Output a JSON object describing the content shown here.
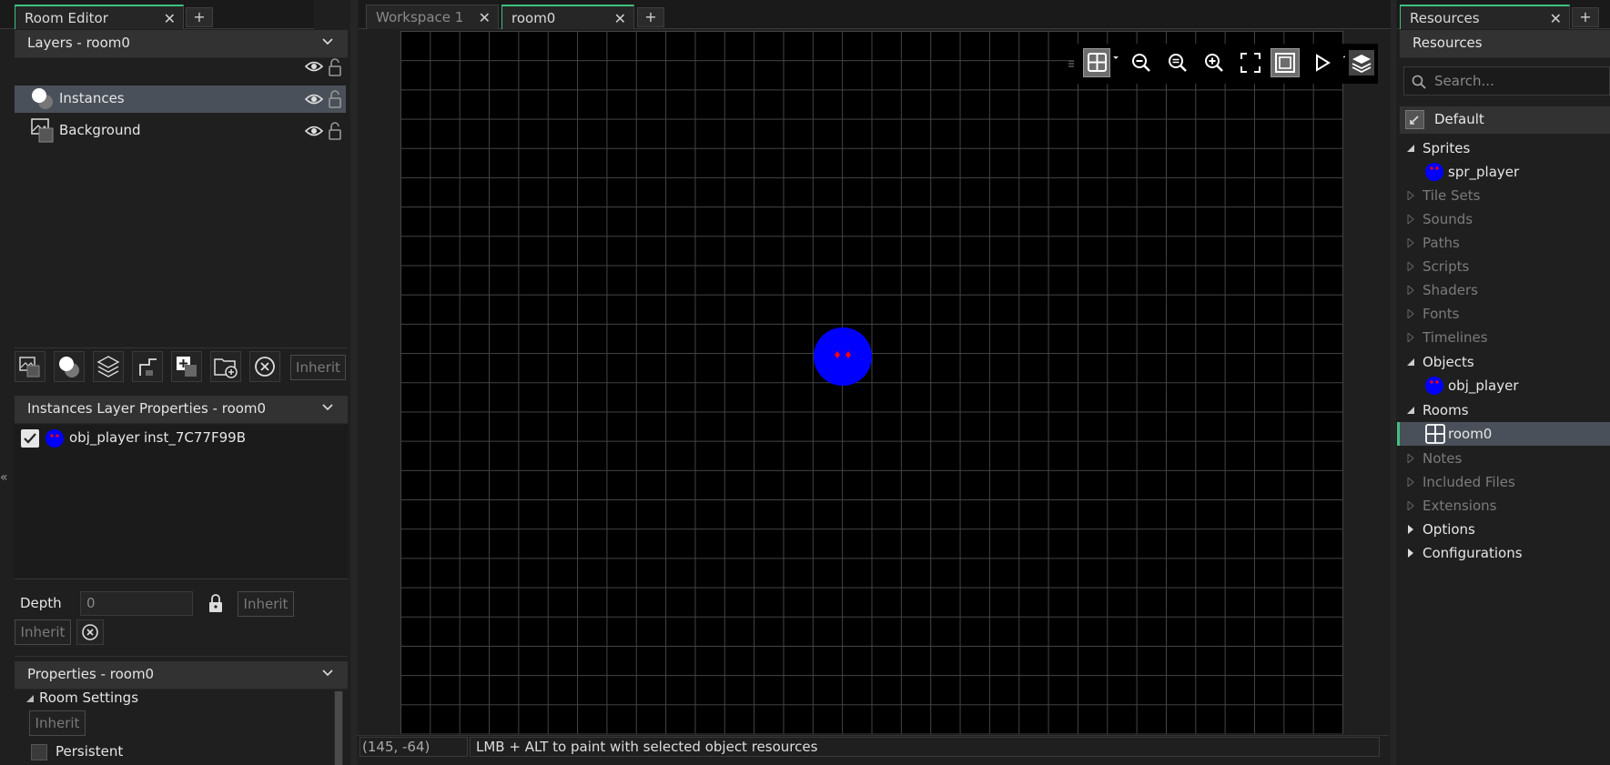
{
  "left": {
    "tab_label": "Room Editor",
    "layers_header": "Layers - room0",
    "layers": [
      {
        "name": "Instances",
        "icon": "instances-layer-icon",
        "selected": true
      },
      {
        "name": "Background",
        "icon": "background-layer-icon",
        "selected": false
      }
    ],
    "inherit_label": "Inherit",
    "inst_props_header": "Instances Layer Properties - room0",
    "instance": {
      "object": "obj_player",
      "id": "inst_7C77F99B",
      "checked": true
    },
    "depth_label": "Depth",
    "depth_value": "0",
    "inherit_depth_label": "Inherit",
    "inherit_layer_label": "Inherit",
    "properties_header": "Properties - room0",
    "room_settings_label": "Room Settings",
    "room_inherit_label": "Inherit",
    "persistent_label": "Persistent"
  },
  "center": {
    "tabs": [
      {
        "label": "Workspace 1",
        "active": false
      },
      {
        "label": "room0",
        "active": true
      }
    ],
    "toolbar": [
      "grid-toggle-icon",
      "zoom-out-icon",
      "zoom-reset-icon",
      "zoom-in-icon",
      "fit-icon",
      "frame-icon",
      "play-icon",
      "layers-toggle-icon"
    ],
    "status_coords": "(145, -64)",
    "status_hint": "LMB + ALT to paint with selected object resources"
  },
  "right": {
    "tab_label": "Resources",
    "header": "Resources",
    "search_placeholder": "Search...",
    "filter_label": "Default",
    "tree": [
      {
        "label": "Sprites",
        "expanded": true,
        "dim": false,
        "children": [
          "spr_player"
        ]
      },
      {
        "label": "Tile Sets",
        "expanded": false,
        "dim": true
      },
      {
        "label": "Sounds",
        "expanded": false,
        "dim": true
      },
      {
        "label": "Paths",
        "expanded": false,
        "dim": true
      },
      {
        "label": "Scripts",
        "expanded": false,
        "dim": true
      },
      {
        "label": "Shaders",
        "expanded": false,
        "dim": true
      },
      {
        "label": "Fonts",
        "expanded": false,
        "dim": true
      },
      {
        "label": "Timelines",
        "expanded": false,
        "dim": true
      },
      {
        "label": "Objects",
        "expanded": true,
        "dim": false,
        "children": [
          "obj_player"
        ]
      },
      {
        "label": "Rooms",
        "expanded": true,
        "dim": false,
        "children": [
          "room0"
        ]
      },
      {
        "label": "Notes",
        "expanded": false,
        "dim": true
      },
      {
        "label": "Included Files",
        "expanded": false,
        "dim": true
      },
      {
        "label": "Extensions",
        "expanded": false,
        "dim": true
      },
      {
        "label": "Options",
        "expanded": false,
        "dim": false
      },
      {
        "label": "Configurations",
        "expanded": false,
        "dim": false
      }
    ]
  },
  "colors": {
    "accent": "#3fc180",
    "player_body": "#0000ff",
    "player_eyes": "#ff0000",
    "selection": "#4a5059"
  }
}
